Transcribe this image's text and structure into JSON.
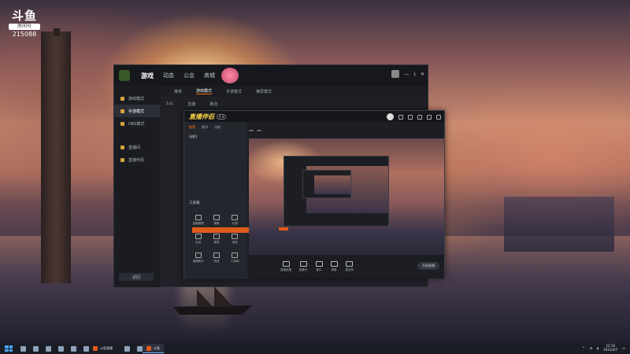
{
  "overlay": {
    "logo_mark": "斗鱼",
    "logo_sub": "房间号",
    "room_number": "215088"
  },
  "main_window": {
    "nav": [
      "游戏",
      "动态",
      "公会",
      "商城"
    ],
    "nav_active_index": 0,
    "promo": "",
    "sidebar": [
      "游戏模式",
      "手游模式",
      "OBS模式",
      "直播间",
      "直播伴侣"
    ],
    "sidebar_active_index": 1,
    "sidebar_bottom": "返回",
    "subtabs": [
      "推荐",
      "游戏模式",
      "手游模式",
      "横屏模式"
    ],
    "subtab_active_index": 1,
    "row_items": [
      "1x1",
      "直播",
      "推流"
    ]
  },
  "tool_window": {
    "title": "直播伴侣",
    "badge": "6.4",
    "left_tabs": [
      "推荐",
      "素材",
      "功能"
    ],
    "left_tab_active_index": 0,
    "scene": "场景1",
    "tools_title": "工具箱",
    "tools": [
      "直播管理",
      "弹幕",
      "礼物",
      "互动",
      "美颜",
      "音效",
      "直播助手",
      "特效",
      "小游戏"
    ],
    "banner": "",
    "notice": "",
    "head_title": "",
    "head_pills": [
      "",
      ""
    ],
    "bottom_buttons": [
      "直播设置",
      "摄像头",
      "窗口",
      "屏幕",
      "麦克风"
    ],
    "live_button": "开始直播"
  },
  "taskbar": {
    "apps": [
      "斗鱼直播",
      "斗鱼"
    ],
    "active_app_index": 1,
    "time": "12:16",
    "date": "2021/4/7"
  },
  "colors": {
    "accent_orange": "#e05a1a",
    "window_bg": "#1f2127",
    "taskbar_bg": "#1a1d26"
  }
}
